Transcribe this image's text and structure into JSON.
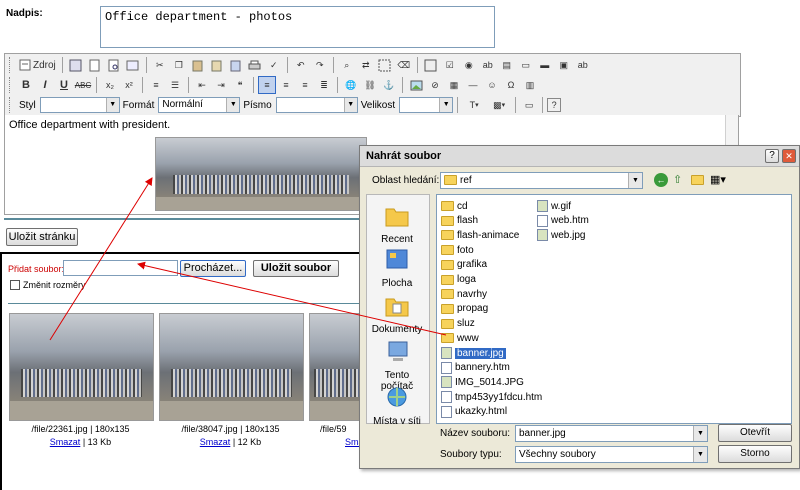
{
  "title_field": {
    "label": "Nadpis:",
    "value": "Office department - photos"
  },
  "toolbar": {
    "source_label": "Zdroj",
    "style_label": "Styl",
    "format_label": "Formát",
    "format_value": "Normální",
    "font_label": "Písmo",
    "size_label": "Velikost"
  },
  "editor": {
    "text": "Office department with president."
  },
  "save_page_button": "Uložit stránku",
  "upload": {
    "label": "Přidat soubor:",
    "browse_button": "Procházet...",
    "save_file_button": "Uložit soubor",
    "resize_label": "Změnit rozměry"
  },
  "gallery": [
    {
      "path": "/file/22361.jpg",
      "dims": "180x135",
      "delete": "Smazat",
      "size": "13 Kb"
    },
    {
      "path": "/file/38047.jpg",
      "dims": "180x135",
      "delete": "Smazat",
      "size": "12 Kb"
    },
    {
      "path": "/file/59",
      "dims": "",
      "delete": "Smaz",
      "size": ""
    }
  ],
  "dialog": {
    "title": "Nahrát soubor",
    "look_in_label": "Oblast hledání:",
    "look_in_value": "ref",
    "places": [
      "Recent",
      "Plocha",
      "Dokumenty",
      "Tento počítač",
      "Místa v síti"
    ],
    "files_col1": [
      {
        "name": "cd",
        "type": "folder"
      },
      {
        "name": "flash",
        "type": "folder"
      },
      {
        "name": "flash-animace",
        "type": "folder"
      },
      {
        "name": "foto",
        "type": "folder"
      },
      {
        "name": "grafika",
        "type": "folder"
      },
      {
        "name": "loga",
        "type": "folder"
      },
      {
        "name": "navrhy",
        "type": "folder"
      },
      {
        "name": "propag",
        "type": "folder"
      },
      {
        "name": "sluz",
        "type": "folder"
      },
      {
        "name": "www",
        "type": "folder"
      },
      {
        "name": "banner.jpg",
        "type": "image"
      },
      {
        "name": "bannery.htm",
        "type": "file"
      },
      {
        "name": "IMG_5014.JPG",
        "type": "image"
      },
      {
        "name": "tmp453yy1fdcu.htm",
        "type": "file"
      },
      {
        "name": "ukazky.html",
        "type": "file"
      }
    ],
    "files_col2": [
      {
        "name": "w.gif",
        "type": "image"
      },
      {
        "name": "web.htm",
        "type": "file"
      },
      {
        "name": "web.jpg",
        "type": "image"
      }
    ],
    "selected_file": "banner.jpg",
    "filename_label": "Název souboru:",
    "filename_value": "banner.jpg",
    "filetype_label": "Soubory typu:",
    "filetype_value": "Všechny soubory",
    "open_button": "Otevřít",
    "cancel_button": "Storno",
    "help_button": "?",
    "close_button": "✕"
  },
  "colors": {
    "red_label": "#cc0000",
    "link": "#0000cc",
    "selection": "#316ac5",
    "arrow": "#dd0000"
  }
}
